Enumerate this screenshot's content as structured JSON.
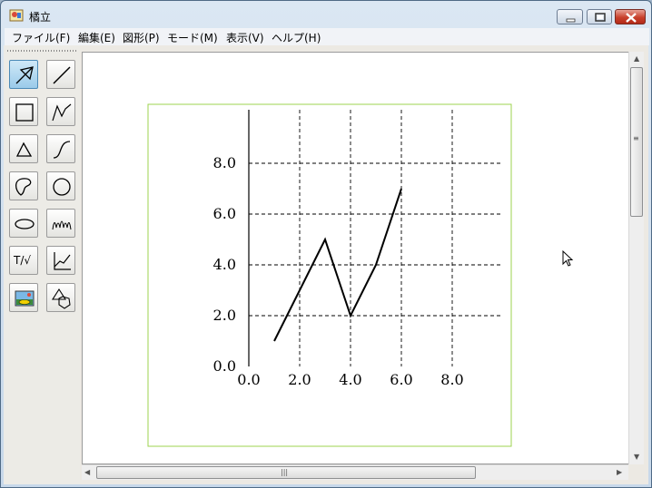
{
  "window": {
    "title": "橘立"
  },
  "menu": [
    "ファイル(F)",
    "編集(E)",
    "図形(P)",
    "モード(M)",
    "表示(V)",
    "ヘルプ(H)"
  ],
  "toolbox": {
    "tools": [
      {
        "name": "select-tool",
        "icon": "arrow-pointer-icon",
        "selected": true
      },
      {
        "name": "line-tool",
        "icon": "line-icon"
      },
      {
        "name": "rectangle-tool",
        "icon": "square-icon"
      },
      {
        "name": "polyline-tool",
        "icon": "polyline-icon"
      },
      {
        "name": "polygon-tool",
        "icon": "triangle-icon"
      },
      {
        "name": "curve-tool",
        "icon": "curve-icon"
      },
      {
        "name": "closed-curve-tool",
        "icon": "closed-curve-icon"
      },
      {
        "name": "circle-tool",
        "icon": "circle-icon"
      },
      {
        "name": "ellipse-tool",
        "icon": "ellipse-icon"
      },
      {
        "name": "function-graph-tool",
        "icon": "wave-icon"
      },
      {
        "name": "text-formula-tool",
        "icon": "text-formula-icon",
        "label": "T/√"
      },
      {
        "name": "graph-axes-tool",
        "icon": "graph-axes-icon"
      },
      {
        "name": "image-tool",
        "icon": "picture-icon"
      },
      {
        "name": "solid-shape-tool",
        "icon": "shapes-icon"
      }
    ]
  },
  "chart_data": {
    "type": "line",
    "x": [
      1.0,
      3.0,
      4.0,
      5.0,
      6.0
    ],
    "y": [
      1.0,
      5.0,
      2.0,
      4.0,
      7.0
    ],
    "xlim": [
      0.0,
      10.0
    ],
    "ylim": [
      0.0,
      10.0
    ],
    "xticks": [
      "0.0",
      "2.0",
      "4.0",
      "6.0",
      "8.0"
    ],
    "yticks": [
      "0.0",
      "2.0",
      "4.0",
      "6.0",
      "8.0"
    ],
    "grid": true,
    "title": "",
    "xlabel": "",
    "ylabel": ""
  },
  "colors": {
    "frame": "#9ed34f",
    "line": "#000000",
    "grid": "#000000"
  },
  "scrollbars": {
    "v_grip": "≡",
    "h_grip": "|||"
  }
}
